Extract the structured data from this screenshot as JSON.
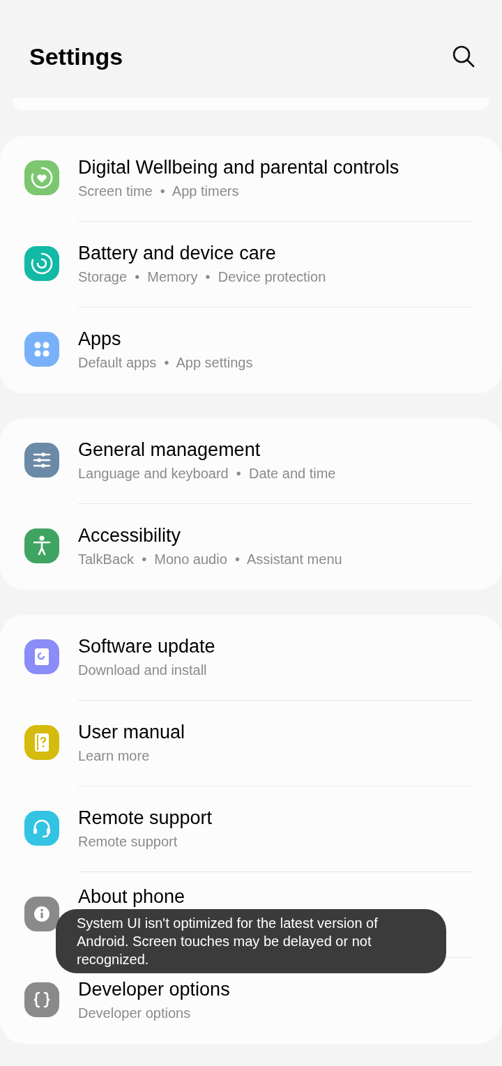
{
  "header": {
    "title": "Settings"
  },
  "groups": [
    {
      "items": [
        {
          "title": "Digital Wellbeing and parental controls",
          "subtitle": "Screen time  •  App timers",
          "color": "#7bc66f"
        },
        {
          "title": "Battery and device care",
          "subtitle": "Storage  •  Memory  •  Device protection",
          "color": "#12b9a5"
        },
        {
          "title": "Apps",
          "subtitle": "Default apps  •  App settings",
          "color": "#78b1fa"
        }
      ]
    },
    {
      "items": [
        {
          "title": "General management",
          "subtitle": "Language and keyboard  •  Date and time",
          "color": "#6b8aa6"
        },
        {
          "title": "Accessibility",
          "subtitle": "TalkBack  •  Mono audio  •  Assistant menu",
          "color": "#3fa462"
        }
      ]
    },
    {
      "items": [
        {
          "title": "Software update",
          "subtitle": "Download and install",
          "color": "#8a8cf7"
        },
        {
          "title": "User manual",
          "subtitle": "Learn more",
          "color": "#d4bb0c"
        },
        {
          "title": "Remote support",
          "subtitle": "Remote support",
          "color": "#33c3e3"
        },
        {
          "title": "About phone",
          "color": "#8a8a8a"
        },
        {
          "title": "Developer options",
          "subtitle": "Developer options",
          "color": "#8a8a8a"
        }
      ]
    }
  ],
  "toast": {
    "text": "System UI isn't optimized for the latest version of Android. Screen touches may be delayed or not recognized."
  }
}
